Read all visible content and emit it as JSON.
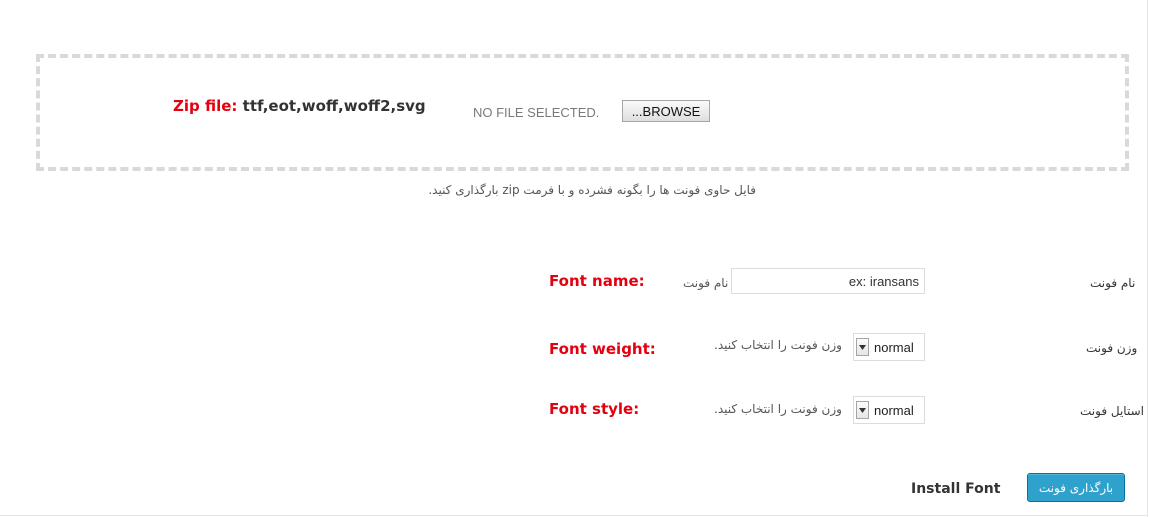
{
  "upload": {
    "zip_label_prefix": "Zip file:",
    "zip_label_formats": "ttf,eot,woff,woff2,svg",
    "no_file_text": "NO FILE SELECTED.",
    "browse_label": "...BROWSE",
    "hint": "فایل حاوی فونت ها را بگونه فشرده و با فرمت zip بارگذاری کنید."
  },
  "font_name": {
    "label_en": "Font name:",
    "label_fa": "نام فونت",
    "inline_label": "نام فونت",
    "placeholder": "ex: iransans"
  },
  "font_weight": {
    "label_en": "Font weight:",
    "label_fa": "وزن فونت",
    "hint": "وزن فونت را انتخاب کنید.",
    "selected": "normal"
  },
  "font_style": {
    "label_en": "Font style:",
    "label_fa": "استایل فونت",
    "hint": "وزن فونت را انتخاب کنید.",
    "selected": "normal"
  },
  "install": {
    "label_en": "Install Font",
    "button_label": "بارگذاری فونت"
  },
  "colors": {
    "accent_red": "#e3000f",
    "button_blue": "#2ea2cc"
  }
}
